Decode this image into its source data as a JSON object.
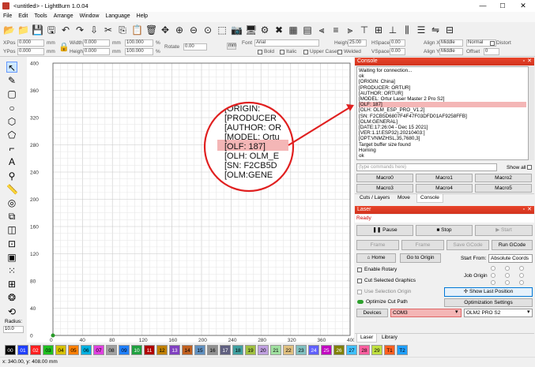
{
  "window": {
    "title": "<untitled> - LightBurn 1.0.04",
    "min": "—",
    "max": "☐",
    "close": "✕"
  },
  "menu": [
    "File",
    "Edit",
    "Tools",
    "Arrange",
    "Window",
    "Language",
    "Help"
  ],
  "toolbar_icons": [
    "folder-open-icon",
    "folder-icon",
    "save-icon",
    "save-as-icon",
    "undo-icon",
    "redo-icon",
    "import-icon",
    "cut-icon",
    "copy-icon",
    "paste-icon",
    "delete-icon",
    "move-icon",
    "zoom-in-icon",
    "zoom-out-icon",
    "zoom-fit-icon",
    "frame-icon",
    "camera-icon",
    "monitor-icon",
    "settings-icon",
    "tools-icon",
    "group-icon",
    "ungroup-icon",
    "align-left-icon",
    "align-center-icon",
    "align-right-icon",
    "align-top-icon",
    "align-middle-icon",
    "align-bottom-icon",
    "distribute-h-icon",
    "distribute-v-icon",
    "mirror-icon",
    "grid-icon"
  ],
  "props": {
    "xpos_label": "XPos",
    "xpos": "0.000",
    "ypos_label": "YPos",
    "ypos": "0.000",
    "unit": "mm",
    "width_label": "Width",
    "width": "0.000",
    "height_label": "Height",
    "height": "0.000",
    "scale_w": "100.000",
    "scale_h": "100.000",
    "pct": "%",
    "rotate_label": "Rotate",
    "rotate": "0.00",
    "mm_btn": "mm",
    "font_label": "Font",
    "font": "Arial",
    "height2_label": "Height",
    "height2": "25.00",
    "hspace_label": "HSpace",
    "hspace": "0.00",
    "vspace_label": "VSpace",
    "vspace": "0.00",
    "alignx_label": "Align X",
    "alignx": "Middle",
    "aligny_label": "Align Y",
    "aligny": "Middle",
    "normal": "Normal",
    "offset_label": "Offset",
    "offset": "0",
    "bold": "Bold",
    "italic": "Italic",
    "upper": "Upper Case",
    "welded": "Welded",
    "distort": "Distort"
  },
  "left_tools": [
    "select-icon",
    "draw-lines-icon",
    "rectangle-icon",
    "ellipse-icon",
    "polygon-icon",
    "polygon2-icon",
    "edit-nodes-icon",
    "text-icon",
    "position-icon",
    "measure-icon",
    "offset-icon",
    "boolean-union-icon",
    "boolean-subtract-icon",
    "boolean-intersect-icon",
    "weld-icon",
    "array-icon",
    "grid-array-icon",
    "circular-array-icon",
    "rotary-icon"
  ],
  "radius": {
    "label": "Radius:",
    "value": "10.0"
  },
  "canvas": {
    "y_ticks": [
      "400",
      "360",
      "320",
      "280",
      "240",
      "200",
      "160",
      "120",
      "80",
      "40",
      "0"
    ],
    "x_ticks": [
      "0",
      "40",
      "80",
      "120",
      "160",
      "200",
      "240",
      "280",
      "320",
      "360",
      "400"
    ],
    "zoom_lines": [
      "[ORIGIN:",
      "[PRODUCER",
      "[AUTHOR: OR",
      "[MODEL: Ortu",
      "[OLF: 187]",
      "[OLH: OLM_E",
      "[SN: F2CB5D",
      "[OLM:GENE"
    ]
  },
  "console": {
    "title": "Console",
    "lines": [
      "Waiting for connection...",
      "ok",
      "[ORIGIN: China]",
      "[PRODUCER: ORTUR]",
      "[AUTHOR: ORTUR]",
      "[MODEL: Ortur Laser Master 2 Pro S2]",
      "[OLF: 187]",
      "[OLH: OLM_ESP_PRO_V1.2]",
      "[SN: F2CB5D6807F4F47F03DFD01AF9258FFB]",
      "[OLM:GENERAL]",
      "[DATE:17:26:04 - Dec 15 2021]",
      "[VER:1.1f.ESP32).20210403:]",
      "[OPT:VNMZHSL,35,7680,3]",
      "Target buffer size found",
      "Homing",
      "ok"
    ],
    "cmd_placeholder": "(type commands here)",
    "show_all": "Show all",
    "macros": [
      "Macro0",
      "Macro1",
      "Macro2",
      "Macro3",
      "Macro4",
      "Macro5"
    ],
    "tabs": [
      "Cuts / Layers",
      "Move",
      "Console"
    ]
  },
  "laser": {
    "title": "Laser",
    "status": "Ready",
    "pause": "Pause",
    "stop": "Stop",
    "start": "Start",
    "frame1": "Frame",
    "frame2": "Frame",
    "save_gcode": "Save GCode",
    "run_gcode": "Run GCode",
    "home": "Home",
    "go_origin": "Go to Origin",
    "start_from_label": "Start From:",
    "start_from": "Absolute Coords",
    "enable_rotary": "Enable Rotary",
    "job_origin": "Job Origin",
    "cut_selected": "Cut Selected Graphics",
    "use_selection_origin": "Use Selection Origin",
    "show_last": "Show Last Position",
    "optimize_cut": "Optimize Cut Path",
    "opt_settings": "Optimization Settings",
    "devices": "Devices",
    "com": "COM3",
    "device": "OLM2 PRO S2",
    "tabs": [
      "Laser",
      "Library"
    ]
  },
  "palette": [
    {
      "n": "00",
      "c": "#000000",
      "t": "#ffffff"
    },
    {
      "n": "01",
      "c": "#1f3fff",
      "t": "#ffffff"
    },
    {
      "n": "02",
      "c": "#ff2020",
      "t": "#ffffff"
    },
    {
      "n": "03",
      "c": "#20c020",
      "t": "#000000"
    },
    {
      "n": "04",
      "c": "#d6c000",
      "t": "#000000"
    },
    {
      "n": "05",
      "c": "#ff8000",
      "t": "#000000"
    },
    {
      "n": "06",
      "c": "#00b0e0",
      "t": "#000000"
    },
    {
      "n": "07",
      "c": "#e040e0",
      "t": "#000000"
    },
    {
      "n": "08",
      "c": "#a0a0a0",
      "t": "#000000"
    },
    {
      "n": "09",
      "c": "#2080ff",
      "t": "#000000"
    },
    {
      "n": "10",
      "c": "#20a040",
      "t": "#ffffff"
    },
    {
      "n": "11",
      "c": "#b00000",
      "t": "#ffffff"
    },
    {
      "n": "12",
      "c": "#c08000",
      "t": "#000000"
    },
    {
      "n": "13",
      "c": "#8040c0",
      "t": "#ffffff"
    },
    {
      "n": "14",
      "c": "#c06020",
      "t": "#000000"
    },
    {
      "n": "15",
      "c": "#6090c0",
      "t": "#000000"
    },
    {
      "n": "16",
      "c": "#909090",
      "t": "#000000"
    },
    {
      "n": "17",
      "c": "#606080",
      "t": "#ffffff"
    },
    {
      "n": "18",
      "c": "#40a0a0",
      "t": "#000000"
    },
    {
      "n": "19",
      "c": "#a0c040",
      "t": "#000000"
    },
    {
      "n": "20",
      "c": "#c0a0e0",
      "t": "#000000"
    },
    {
      "n": "21",
      "c": "#a0e0a0",
      "t": "#000000"
    },
    {
      "n": "22",
      "c": "#e0c080",
      "t": "#000000"
    },
    {
      "n": "23",
      "c": "#80c0c0",
      "t": "#000000"
    },
    {
      "n": "24",
      "c": "#6060ff",
      "t": "#ffffff"
    },
    {
      "n": "25",
      "c": "#c000c0",
      "t": "#ffffff"
    },
    {
      "n": "26",
      "c": "#808000",
      "t": "#ffffff"
    },
    {
      "n": "27",
      "c": "#40c0ff",
      "t": "#000000"
    },
    {
      "n": "28",
      "c": "#ff60a0",
      "t": "#000000"
    },
    {
      "n": "29",
      "c": "#c0e040",
      "t": "#000000"
    },
    {
      "n": "T1",
      "c": "#ff6020",
      "t": "#000000"
    },
    {
      "n": "T2",
      "c": "#20a0ff",
      "t": "#000000"
    }
  ],
  "status": "x: 340.00, y: 408.00 mm",
  "colors": {
    "accent": "#d2331e",
    "highlight_row": "#f4b6b6",
    "annotation": "#e02020"
  }
}
